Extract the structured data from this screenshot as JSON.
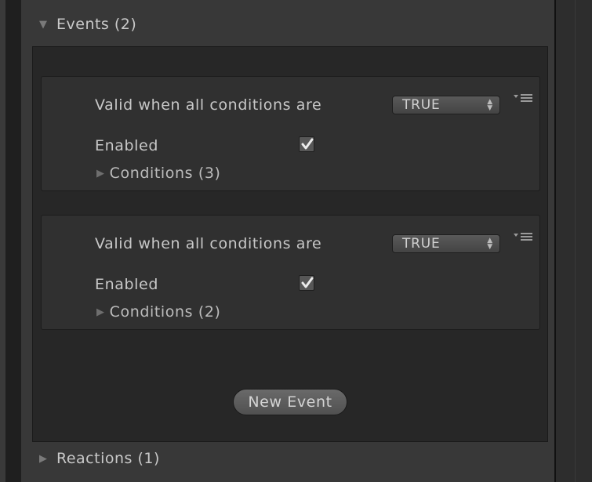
{
  "events_foldout": {
    "arrow": "▼",
    "label": "Events (2)"
  },
  "events": [
    {
      "valid_label": "Valid when all conditions are",
      "select_value": "TRUE",
      "enabled_label": "Enabled",
      "enabled": true,
      "conditions_label": "Conditions (3)"
    },
    {
      "valid_label": "Valid when all conditions are",
      "select_value": "TRUE",
      "enabled_label": "Enabled",
      "enabled": true,
      "conditions_label": "Conditions (2)"
    }
  ],
  "new_event_label": "New Event",
  "reactions_foldout": {
    "arrow": "▶",
    "label": "Reactions (1)"
  },
  "icons": {
    "foldout_open": "triangle-down-icon",
    "foldout_closed": "triangle-right-icon",
    "select": "up-down-icon",
    "menu": "context-menu-icon",
    "check": "checkmark-icon"
  }
}
